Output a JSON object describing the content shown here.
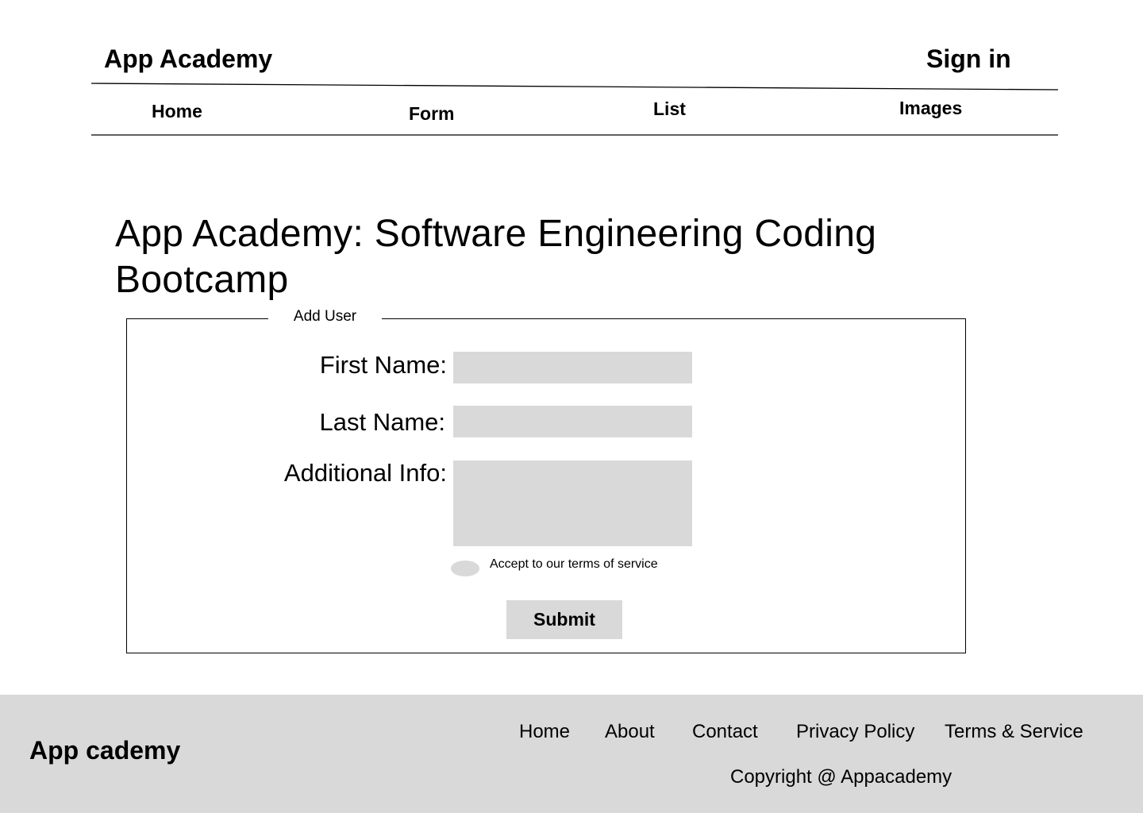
{
  "header": {
    "brand": "App Academy",
    "sign_in": "Sign in"
  },
  "nav": {
    "items": [
      {
        "label": "Home"
      },
      {
        "label": "Form"
      },
      {
        "label": "List"
      },
      {
        "label": "Images"
      }
    ]
  },
  "main": {
    "title": "App Academy: Software Engineering Coding Bootcamp"
  },
  "form": {
    "legend": "Add User",
    "first_name_label": "First Name:",
    "first_name_value": "",
    "last_name_label": "Last Name:",
    "last_name_value": "",
    "additional_info_label": "Additional Info:",
    "additional_info_value": "",
    "terms_label": "Accept to our terms of service",
    "submit_label": "Submit",
    "field_color": "#d9d9d9"
  },
  "footer": {
    "brand": "App cademy",
    "links": [
      {
        "label": "Home"
      },
      {
        "label": "About"
      },
      {
        "label": "Contact"
      },
      {
        "label": "Privacy Policy"
      },
      {
        "label": "Terms & Service"
      }
    ],
    "copyright": "Copyright @ Appacademy",
    "background": "#d9d9d9"
  }
}
